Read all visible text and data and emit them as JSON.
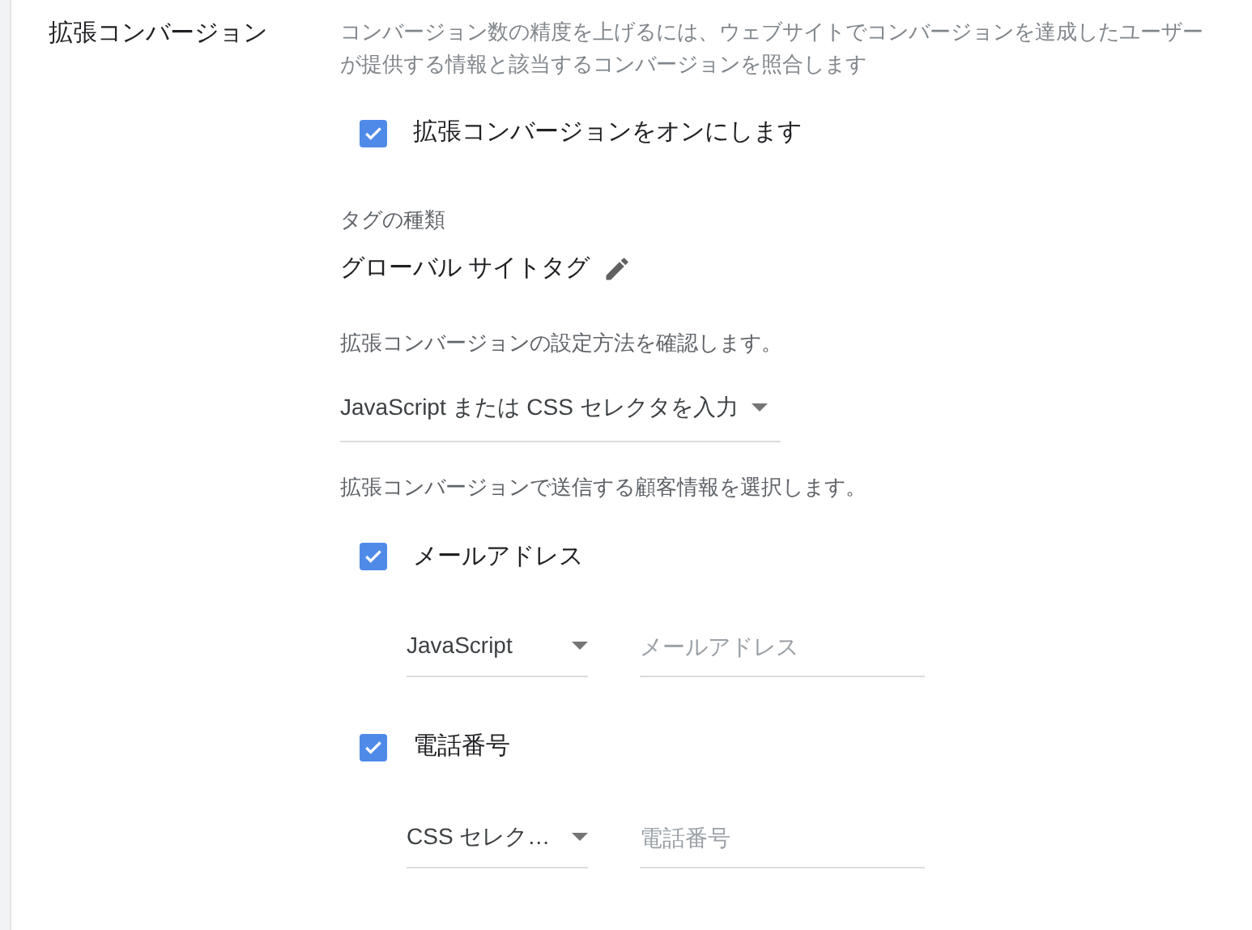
{
  "section": {
    "title": "拡張コンバージョン",
    "description": "コンバージョン数の精度を上げるには、ウェブサイトでコンバージョンを達成したユーザーが提供する情報と該当するコンバージョンを照合します"
  },
  "enable": {
    "label": "拡張コンバージョンをオンにします",
    "checked": true
  },
  "tag_type": {
    "label": "タグの種類",
    "value": "グローバル サイトタグ"
  },
  "method": {
    "prompt": "拡張コンバージョンの設定方法を確認します。",
    "value": "JavaScript または CSS セレクタを入力"
  },
  "customer_info": {
    "prompt": "拡張コンバージョンで送信する顧客情報を選択します。",
    "items": [
      {
        "label": "メールアドレス",
        "checked": true,
        "source": "JavaScript",
        "placeholder": "メールアドレス"
      },
      {
        "label": "電話番号",
        "checked": true,
        "source": "CSS セレク…",
        "placeholder": "電話番号"
      }
    ]
  }
}
